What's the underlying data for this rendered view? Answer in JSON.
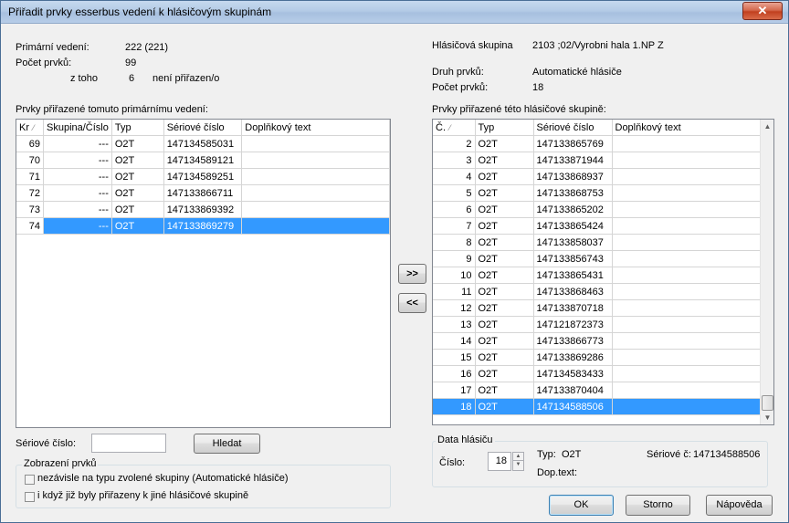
{
  "window": {
    "title": "Přiřadit prvky esserbus vedení k hlásičovým skupinám",
    "close_glyph": "✕"
  },
  "left_info": {
    "primary_label": "Primární vedení:",
    "primary_value": "222 (221)",
    "count_label": "Počet prvků:",
    "count_value": "99",
    "of_which_label": "z toho",
    "of_which_value": "6",
    "unassigned_label": "není přiřazen/o"
  },
  "right_info": {
    "group_label": "Hlásičová skupina",
    "group_value": "2103 ;02/Vyrobni hala 1.NP Z",
    "type_label": "Druh prvků:",
    "type_value": "Automatické hlásiče",
    "count_label": "Počet prvků:",
    "count_value": "18"
  },
  "left_grid": {
    "caption": "Prvky přiřazené tomuto primárnímu vedení:",
    "headers": [
      "Kr",
      "Skupina/Číslo",
      "Typ",
      "Sériové číslo",
      "Doplňkový text"
    ],
    "sort_glyph": "⁄",
    "rows": [
      [
        "69",
        "---",
        "O2T",
        "147134585031",
        ""
      ],
      [
        "70",
        "---",
        "O2T",
        "147134589121",
        ""
      ],
      [
        "71",
        "---",
        "O2T",
        "147134589251",
        ""
      ],
      [
        "72",
        "---",
        "O2T",
        "147133866711",
        ""
      ],
      [
        "73",
        "---",
        "O2T",
        "147133869392",
        ""
      ],
      [
        "74",
        "---",
        "O2T",
        "147133869279",
        ""
      ]
    ],
    "selected_row": 5
  },
  "right_grid": {
    "caption": "Prvky přiřazené této hlásičové skupině:",
    "headers": [
      "Č.",
      "Typ",
      "Sériové číslo",
      "Doplňkový text"
    ],
    "sort_glyph": "⁄",
    "rows": [
      [
        "2",
        "O2T",
        "147133865769",
        ""
      ],
      [
        "3",
        "O2T",
        "147133871944",
        ""
      ],
      [
        "4",
        "O2T",
        "147133868937",
        ""
      ],
      [
        "5",
        "O2T",
        "147133868753",
        ""
      ],
      [
        "6",
        "O2T",
        "147133865202",
        ""
      ],
      [
        "7",
        "O2T",
        "147133865424",
        ""
      ],
      [
        "8",
        "O2T",
        "147133858037",
        ""
      ],
      [
        "9",
        "O2T",
        "147133856743",
        ""
      ],
      [
        "10",
        "O2T",
        "147133865431",
        ""
      ],
      [
        "11",
        "O2T",
        "147133868463",
        ""
      ],
      [
        "12",
        "O2T",
        "147133870718",
        ""
      ],
      [
        "13",
        "O2T",
        "147121872373",
        ""
      ],
      [
        "14",
        "O2T",
        "147133866773",
        ""
      ],
      [
        "15",
        "O2T",
        "147133869286",
        ""
      ],
      [
        "16",
        "O2T",
        "147134583433",
        ""
      ],
      [
        "17",
        "O2T",
        "147133870404",
        ""
      ],
      [
        "18",
        "O2T",
        "147134588506",
        ""
      ]
    ],
    "selected_row": 16
  },
  "transfer": {
    "add_label": ">>",
    "remove_label": "<<"
  },
  "search": {
    "serial_label": "Sériové číslo:",
    "serial_value": "",
    "find_label": "Hledat"
  },
  "display": {
    "title": "Zobrazení prvků",
    "opt1_label": "nezávisle na typu zvolené skupiny (Automatické hlásiče)",
    "opt1_checked": false,
    "opt2_label": "i když již byly přiřazeny k jiné hlásičové skupině",
    "opt2_checked": false
  },
  "detector": {
    "title": "Data hlásiču",
    "number_label": "Číslo:",
    "number_value": "18",
    "type_label": "Typ:",
    "type_value": "O2T",
    "serial_label": "Sériové č:",
    "serial_value": "147134588506",
    "extra_label": "Dop.text:",
    "extra_value": ""
  },
  "footer": {
    "ok_label": "OK",
    "cancel_label": "Storno",
    "help_label": "Nápověda"
  },
  "colors": {
    "selection": "#3399ff",
    "title_gradient": "#b4cbe6",
    "close_red": "#c1401f"
  }
}
